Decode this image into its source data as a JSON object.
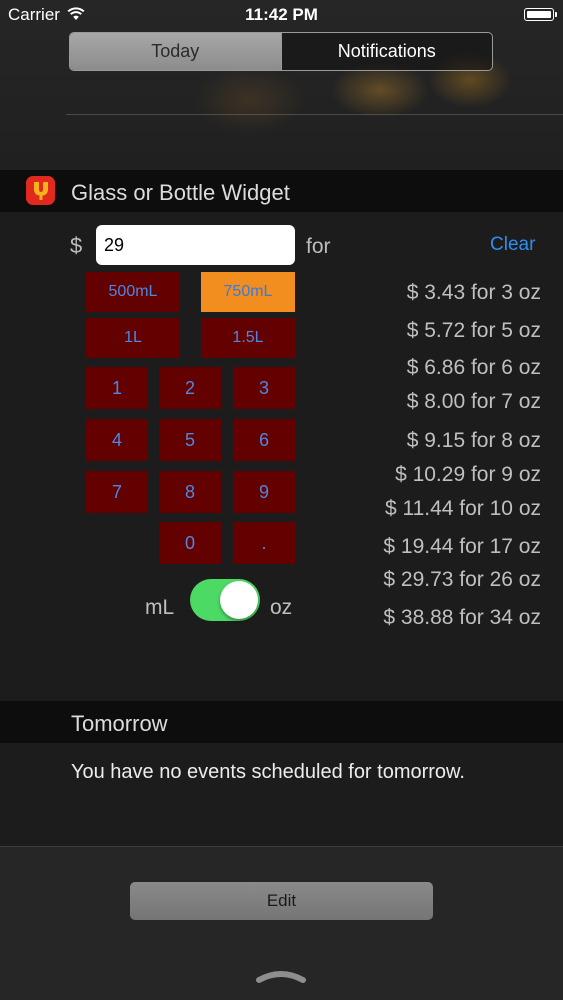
{
  "status_bar": {
    "carrier": "Carrier",
    "time": "11:42 PM"
  },
  "tabs": {
    "today": "Today",
    "notifications": "Notifications"
  },
  "widget": {
    "title": "Glass or Bottle Widget",
    "currency_symbol": "$",
    "amount_value": "29",
    "for_label": "for",
    "clear_label": "Clear",
    "size_buttons": [
      "500mL",
      "750mL",
      "1L",
      "1.5L"
    ],
    "selected_size": "750mL",
    "keypad": [
      "1",
      "2",
      "3",
      "4",
      "5",
      "6",
      "7",
      "8",
      "9",
      "0",
      "."
    ],
    "prices": [
      "$ 3.43 for 3 oz",
      "$ 5.72 for 5 oz",
      "$ 6.86 for 6 oz",
      "$ 8.00 for 7 oz",
      "$ 9.15 for 8 oz",
      "$ 10.29 for 9 oz",
      "$ 11.44 for 10 oz",
      "$ 19.44 for 17 oz",
      "$ 29.73 for 26 oz",
      "$ 38.88 for 34 oz"
    ],
    "unit_left": "mL",
    "unit_right": "oz",
    "unit_toggle_on": true
  },
  "tomorrow": {
    "title": "Tomorrow",
    "message": "You have no events scheduled for tomorrow."
  },
  "edit_label": "Edit",
  "colors": {
    "key_background": "#630000",
    "key_text": "#4f86e3",
    "selected_key": "#f28d1f",
    "toggle_on": "#4cd964",
    "link": "#2e8ef0"
  }
}
